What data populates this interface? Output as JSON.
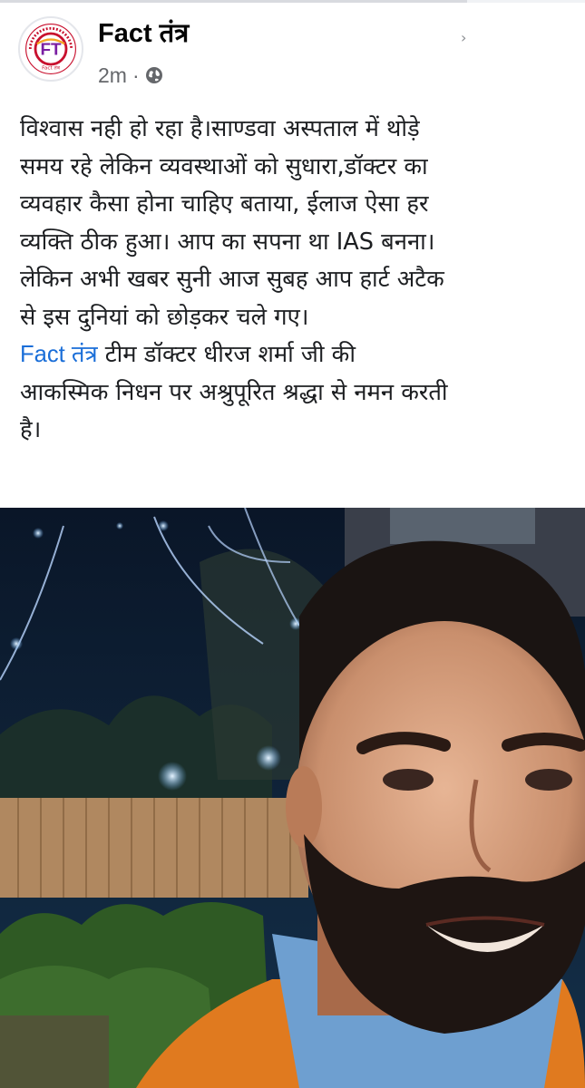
{
  "post": {
    "page_name": "Fact तंत्र",
    "timestamp": "2m",
    "separator": "·",
    "visibility_icon": "globe-icon",
    "avatar": {
      "letters": "FT",
      "ring_text": "ना डरेगा, ना झुकेगा, ना बिकेगा",
      "tagline": "Fact तंत्र",
      "colors": {
        "ring": "#c8102e",
        "letters": "#7a1fa2",
        "accent": "#f5a623"
      }
    },
    "text_lines": [
      "विश्वास नही हो रहा है।साण्डवा अस्पताल में थोड़े",
      "समय रहे लेकिन व्यवस्थाओं को सुधारा,डॉक्टर का",
      "व्यवहार कैसा होना चाहिए बताया, ईलाज ऐसा हर",
      "व्यक्ति ठीक हुआ। आप का सपना था IAS बनना।",
      "लेकिन अभी खबर सुनी आज सुबह आप हार्ट अटैक",
      "से इस दुनियां को छोड़कर चले गए।"
    ],
    "tag": "Fact तंत्र",
    "tag_line_rest": " टीम डॉक्टर धीरज शर्मा जी की",
    "closing_lines": [
      "आकस्मिक निधन पर अश्रुपूरित श्रद्धा से नमन करती",
      "है।"
    ],
    "photo_icon": "portrait-photo",
    "colors": {
      "link": "#1a6ed8",
      "text": "#1c1e21",
      "meta": "#65676b"
    }
  }
}
